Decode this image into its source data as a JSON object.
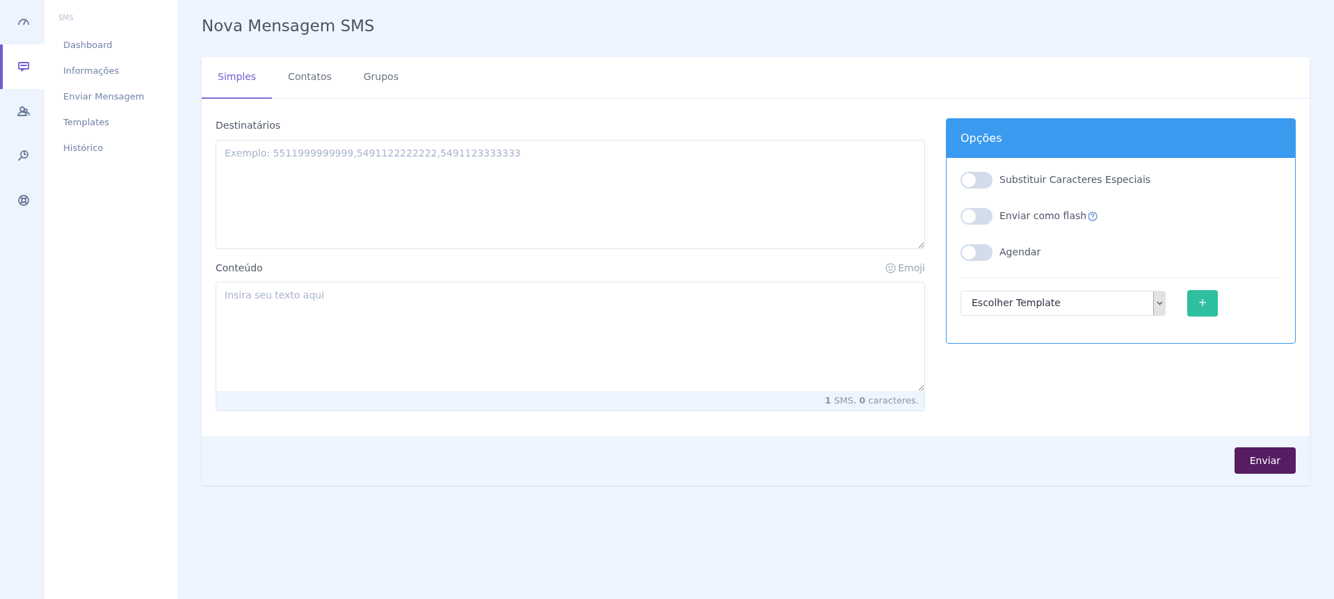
{
  "rail": [
    {
      "kind": "gauge",
      "selected": false
    },
    {
      "kind": "message",
      "selected": true
    },
    {
      "kind": "users",
      "selected": false
    },
    {
      "kind": "search",
      "selected": false
    },
    {
      "kind": "lifebuoy",
      "selected": false
    }
  ],
  "submenu": {
    "heading": "SMS",
    "items": [
      {
        "label": "Dashboard"
      },
      {
        "label": "Informações"
      },
      {
        "label": "Enviar Mensagem"
      },
      {
        "label": "Templates"
      },
      {
        "label": "Histórico"
      }
    ]
  },
  "page_title": "Nova Mensagem SMS",
  "tabs": [
    {
      "label": "Simples",
      "selected": true
    },
    {
      "label": "Contatos",
      "selected": false
    },
    {
      "label": "Grupos",
      "selected": false
    }
  ],
  "recipients": {
    "label": "Destinatários",
    "placeholder": "Exemplo: 5511999999999,5491122222222,5491123333333"
  },
  "content": {
    "label": "Conteúdo",
    "emoji_label": "Emoji",
    "placeholder": "Insira seu texto aqui",
    "counter": "**1** SMS, **0** caracteres."
  },
  "options": {
    "title": "Opções",
    "toggles": [
      {
        "label": "Substituir Caracteres Especiais",
        "on": false,
        "help": false
      },
      {
        "label": "Enviar como flash",
        "on": false,
        "help": true
      },
      {
        "label": "Agendar",
        "on": false,
        "help": false
      }
    ],
    "template_select": {
      "value": "Escolher Template"
    },
    "add_button": "+"
  },
  "send_button": "Enviar"
}
